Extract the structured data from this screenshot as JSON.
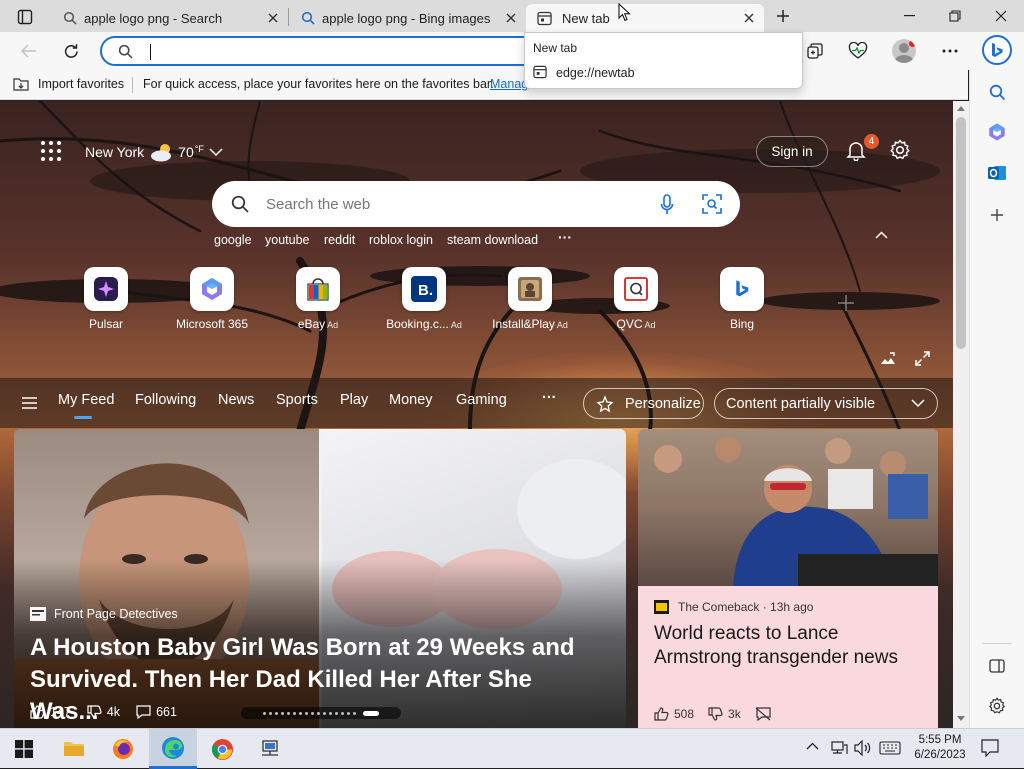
{
  "tabs": [
    {
      "title": "apple logo png - Search",
      "icon": "search-icon"
    },
    {
      "title": "apple logo png - Bing images",
      "icon": "bing-search-icon"
    },
    {
      "title": "New tab",
      "icon": "newtab-icon",
      "active": true
    }
  ],
  "tab_dropdown": {
    "title": "New tab",
    "url": "edge://newtab"
  },
  "address_bar": {
    "value": "",
    "placeholder": ""
  },
  "favorites_bar": {
    "import_label": "Import favorites",
    "hint_text": "For quick access, place your favorites here on the favorites bar.",
    "manage_link": "Manag"
  },
  "weather": {
    "city": "New York",
    "temp": "70",
    "unit": "°F"
  },
  "header": {
    "sign_in": "Sign in",
    "notification_count": "4"
  },
  "search": {
    "placeholder": "Search the web"
  },
  "quick_links": [
    "google",
    "youtube",
    "reddit",
    "roblox login",
    "steam download"
  ],
  "more_glyph": "···",
  "shortcuts": [
    {
      "label": "Pulsar",
      "ad": false
    },
    {
      "label": "Microsoft 365",
      "ad": false
    },
    {
      "label": "eBay",
      "ad": true
    },
    {
      "label": "Booking.c...",
      "ad": true
    },
    {
      "label": "Install&Play",
      "ad": true
    },
    {
      "label": "QVC",
      "ad": true
    },
    {
      "label": "Bing",
      "ad": false
    }
  ],
  "ad_badge": "Ad",
  "feed_nav": {
    "tabs": [
      "My Feed",
      "Following",
      "News",
      "Sports",
      "Play",
      "Money",
      "Gaming"
    ],
    "more": "···",
    "personalize": "Personalize",
    "content_visibility": "Content partially visible"
  },
  "main_card": {
    "source": "Front Page Detectives",
    "headline": "A Houston Baby Girl Was Born at 29 Weeks and Survived. Then Her Dad Killed Her After She Was...",
    "likes": "147",
    "dislikes": "4k",
    "comments": "661"
  },
  "side_card": {
    "source": "The Comeback",
    "time": " · 13h ago",
    "headline": "World reacts to Lance Armstrong transgender news",
    "likes": "508",
    "dislikes": "3k"
  },
  "taskbar": {
    "time": "5:55 PM",
    "date": "6/26/2023"
  },
  "colors": {
    "accent": "#1f6fd1",
    "link": "#0f6cbd",
    "notification": "#e05a2b",
    "side_card_bg": "#f9d9dd"
  }
}
